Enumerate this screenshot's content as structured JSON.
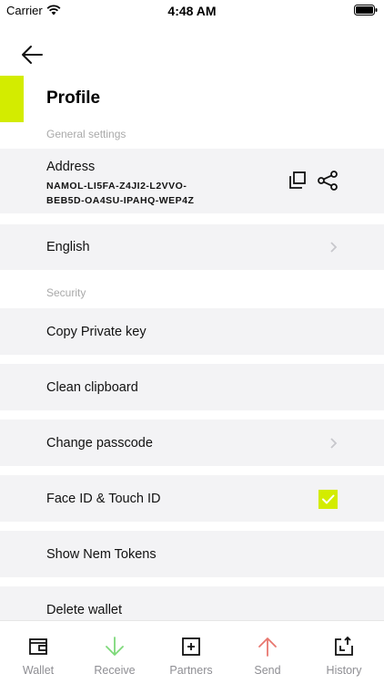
{
  "status_bar": {
    "carrier": "Carrier",
    "time": "4:48 AM"
  },
  "header": {
    "title": "Profile",
    "back_icon": "arrow-left-icon"
  },
  "sections": {
    "general": "General settings",
    "security": "Security"
  },
  "address": {
    "label": "Address",
    "value_line1": "NAMOL-LI5FA-Z4JI2-L2VVO-",
    "value_line2": "BEB5D-OA4SU-IPAHQ-WEP4Z",
    "copy_icon": "copy-icon",
    "share_icon": "share-icon"
  },
  "rows": {
    "language": "English",
    "copy_private_key": "Copy Private key",
    "clean_clipboard": "Clean clipboard",
    "change_passcode": "Change passcode",
    "face_id": "Face ID & Touch ID",
    "show_nem_tokens": "Show Nem Tokens",
    "delete_wallet": "Delete wallet"
  },
  "face_id_enabled": true,
  "colors": {
    "accent": "#d3ec00",
    "row_background": "#f3f3f5",
    "receive_green": "#7ed97a",
    "send_red": "#e8776f"
  },
  "tabs": [
    {
      "label": "Wallet",
      "icon": "wallet-icon"
    },
    {
      "label": "Receive",
      "icon": "arrow-down-icon"
    },
    {
      "label": "Partners",
      "icon": "plus-square-icon"
    },
    {
      "label": "Send",
      "icon": "arrow-up-icon"
    },
    {
      "label": "History",
      "icon": "history-icon"
    }
  ]
}
